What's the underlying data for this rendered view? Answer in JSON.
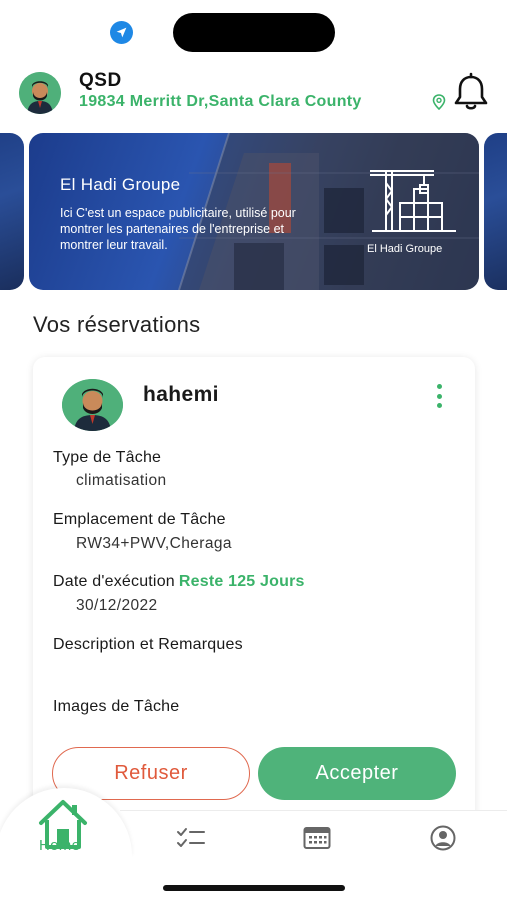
{
  "header": {
    "name": "QSD",
    "address": "19834 Merritt Dr,Santa Clara County"
  },
  "banner": {
    "title": "El Hadi Groupe",
    "text": "Ici C'est un espace publicitaire, utilisé pour montrer les partenaires de l'entreprise et montrer leur travail.",
    "logo_text": "El Hadi Groupe"
  },
  "section": {
    "title": "Vos réservations"
  },
  "reservation": {
    "user": "hahemi",
    "task_type_label": "Type de Tâche",
    "task_type_value": "climatisation",
    "location_label": "Emplacement de Tâche",
    "location_value": "RW34+PWV,Cheraga",
    "date_label": "Date d'exécution",
    "remaining": "Reste 125 Jours",
    "date_value": "30/12/2022",
    "description_label": "Description et Remarques",
    "images_label": "Images de Tâche",
    "refuse_label": "Refuser",
    "accept_label": "Accepter"
  },
  "nav": {
    "home_label": "Home",
    "items": [
      "home-icon",
      "tasks-icon",
      "calendar-icon",
      "profile-icon"
    ]
  },
  "colors": {
    "accent_green": "#3bb36a",
    "refuse_red": "#e05a3c",
    "banner_blue": "#1c3c8c"
  }
}
